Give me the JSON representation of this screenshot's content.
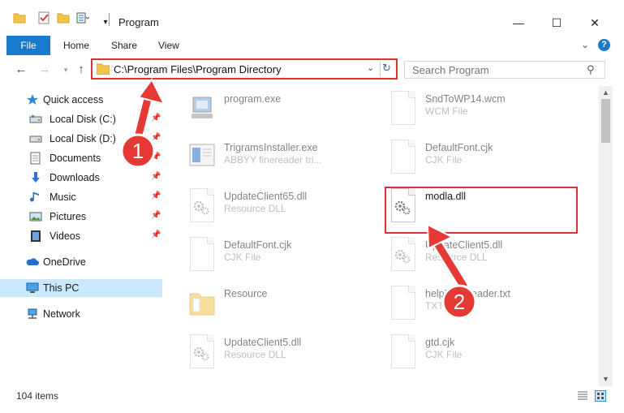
{
  "window": {
    "title": "Program",
    "minimize_icon": "minimize-icon",
    "maximize_icon": "maximize-icon",
    "close_icon": "close-icon"
  },
  "ribbon": {
    "tabs": [
      "File",
      "Home",
      "Share",
      "View"
    ],
    "accent": "#1979ca",
    "help_glyph": "?"
  },
  "navigation": {
    "address": "C:\\Program Files\\Program Directory",
    "search_placeholder": "Search Program"
  },
  "sidebar": {
    "items": [
      {
        "label": "Quick access",
        "icon": "star-icon"
      },
      {
        "label": "Local Disk (C:)",
        "icon": "drive-icon",
        "pinned": true
      },
      {
        "label": "Local Disk (D:)",
        "icon": "drive-icon",
        "pinned": true
      },
      {
        "label": "Documents",
        "icon": "documents-icon",
        "pinned": true
      },
      {
        "label": "Downloads",
        "icon": "download-icon",
        "pinned": true
      },
      {
        "label": "Music",
        "icon": "music-icon",
        "pinned": true
      },
      {
        "label": "Pictures",
        "icon": "pictures-icon",
        "pinned": true
      },
      {
        "label": "Videos",
        "icon": "videos-icon",
        "pinned": true
      },
      {
        "label": "OneDrive",
        "icon": "onedrive-icon"
      },
      {
        "label": "This PC",
        "icon": "pc-icon",
        "selected": true
      },
      {
        "label": "Network",
        "icon": "network-icon"
      }
    ]
  },
  "files": [
    {
      "name": "program.exe",
      "type": "",
      "icon": "program-exe-icon"
    },
    {
      "name": "SndToWP14.wcm",
      "type": "WCM File",
      "icon": "file-icon"
    },
    {
      "name": "TrigramsInstaller.exe",
      "type": "ABBYY finereader tri...",
      "icon": "installer-icon"
    },
    {
      "name": "DefaultFont.cjk",
      "type": "CJK File",
      "icon": "file-icon"
    },
    {
      "name": "UpdateClient65.dll",
      "type": "Resource DLL",
      "icon": "dll-icon"
    },
    {
      "name": "modla.dll",
      "type": "",
      "icon": "dll-icon"
    },
    {
      "name": "DefaultFont.cjk",
      "type": "CJK File",
      "icon": "file-icon"
    },
    {
      "name": "UpdateClient5.dll",
      "type": "Resource DLL",
      "icon": "dll-icon"
    },
    {
      "name": "Resource",
      "type": "",
      "icon": "folder-icon"
    },
    {
      "name": "helpFineReader.txt",
      "type": "TXT File",
      "icon": "text-file-icon"
    },
    {
      "name": "UpdateClient5.dll",
      "type": "Resource DLL",
      "icon": "dll-icon"
    },
    {
      "name": "gtd.cjk",
      "type": "CJK File",
      "icon": "file-icon"
    }
  ],
  "status": {
    "item_count": "104 items"
  },
  "annotations": {
    "steps": [
      "1",
      "2"
    ],
    "highlight_color": "#e03030"
  }
}
